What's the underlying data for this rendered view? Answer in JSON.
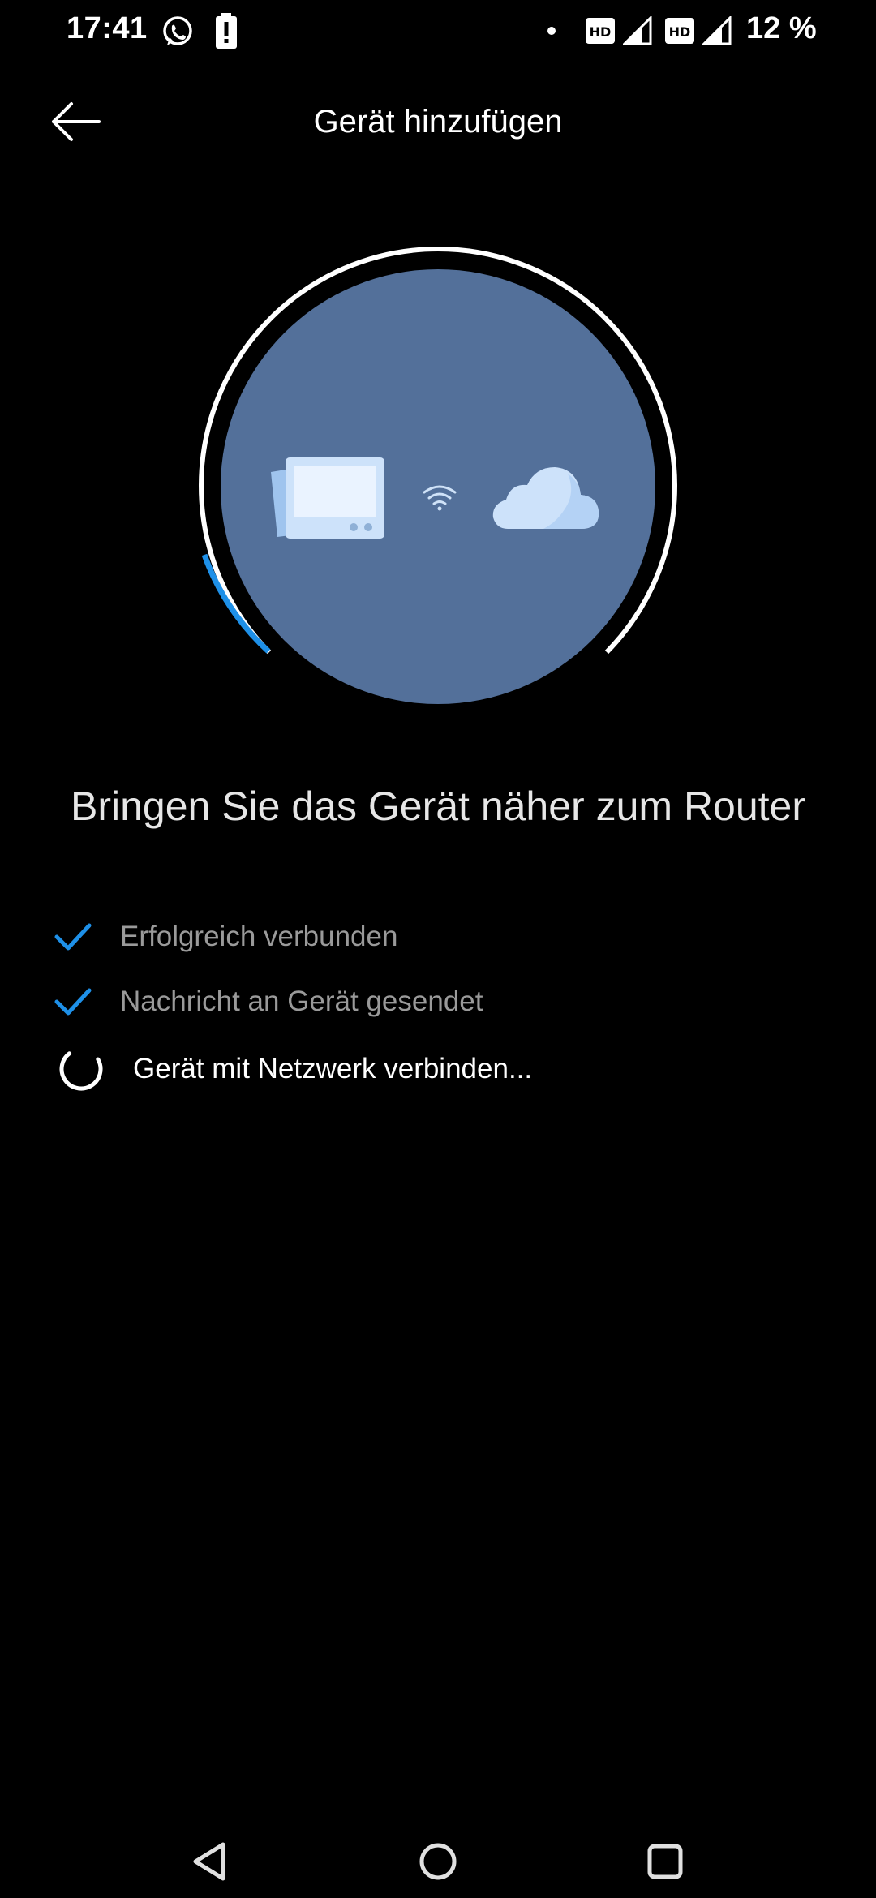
{
  "status_bar": {
    "time": "17:41",
    "battery": "12 %",
    "icons": [
      "whatsapp-icon",
      "battery-alert-icon",
      "dot-icon",
      "hd-icon",
      "signal-icon",
      "hd-icon",
      "signal-icon"
    ]
  },
  "app_bar": {
    "back_icon": "arrow-left-icon",
    "title": "Gerät hinzufügen"
  },
  "illustration": {
    "icons": [
      "device-icon",
      "wifi-icon",
      "cloud-icon"
    ],
    "circle_color": "#53709a",
    "progress_color": "#1e90e8",
    "ring_color": "#ffffff"
  },
  "headline": "Bringen Sie das Gerät näher zum Router",
  "steps": [
    {
      "label": "Erfolgreich verbunden",
      "state": "done",
      "icon": "check-icon"
    },
    {
      "label": "Nachricht an Gerät gesendet",
      "state": "done",
      "icon": "check-icon"
    },
    {
      "label": "Gerät mit Netzwerk verbinden...",
      "state": "in-progress",
      "icon": "spinner-icon"
    }
  ],
  "accent_color": "#1e90e8",
  "nav_bar": {
    "icons": [
      "back-triangle-icon",
      "home-circle-icon",
      "recents-square-icon"
    ]
  }
}
